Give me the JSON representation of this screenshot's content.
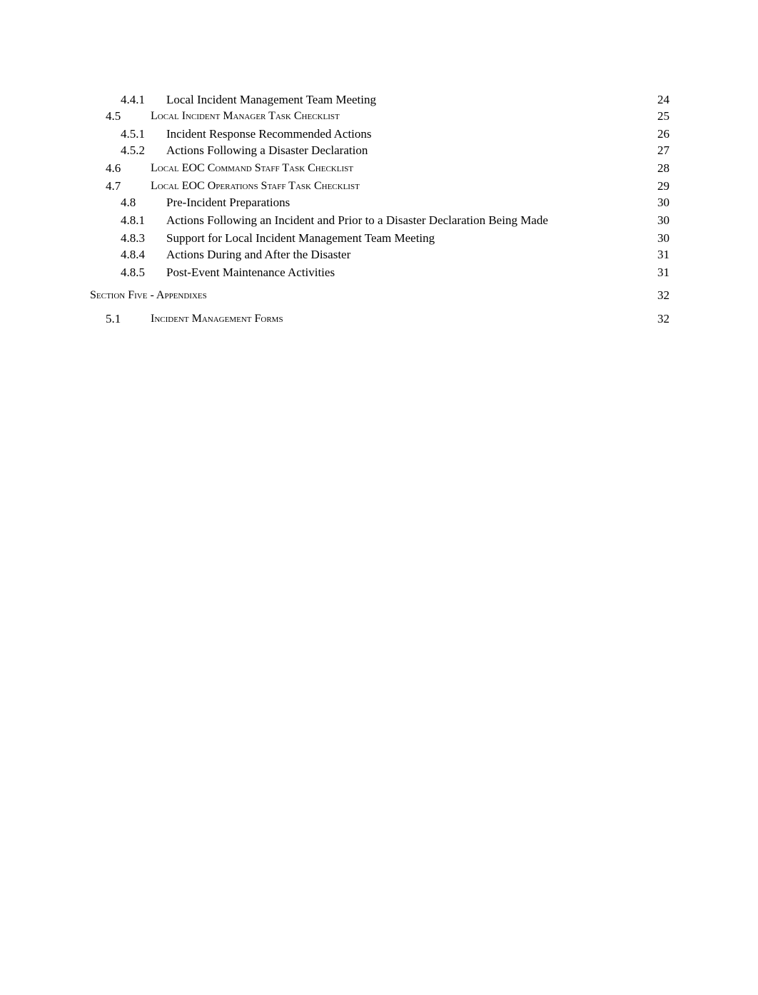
{
  "toc": {
    "entries": [
      {
        "number": "4.4.1",
        "title": "Local Incident Management Team Meeting",
        "page": "24",
        "level": 3
      },
      {
        "number": "4.5",
        "title": "Local Incident Manager Task Checklist",
        "page": "25",
        "level": 2
      },
      {
        "number": "4.5.1",
        "title": "Incident Response Recommended Actions",
        "page": "26",
        "level": 3
      },
      {
        "number": "4.5.2",
        "title": "Actions Following a Disaster Declaration",
        "page": "27",
        "level": 3
      },
      {
        "number": "4.6",
        "title": "Local EOC Command Staff  Task Checklist",
        "page": "28",
        "level": 2
      },
      {
        "number": "4.7",
        "title": "Local EOC Operations  Staff  Task Checklist",
        "page": "29",
        "level": 2
      },
      {
        "number": "4.8",
        "title": "Pre-Incident Preparations",
        "page": "30",
        "level": 3
      },
      {
        "number": "4.8.1",
        "title": "Actions Following an Incident and Prior to a Disaster Declaration Being Made",
        "page": "30",
        "level": 3
      },
      {
        "number": "4.8.3",
        "title": "Support for Local Incident Management Team Meeting",
        "page": "30",
        "level": 3
      },
      {
        "number": "4.8.4",
        "title": "Actions During and After the Disaster",
        "page": "31",
        "level": 3
      },
      {
        "number": "4.8.5",
        "title": "Post-Event Maintenance Activities",
        "page": "31",
        "level": 3
      },
      {
        "number": "",
        "title": "Section  Five - Appendixes",
        "page": "32",
        "level": 1
      },
      {
        "number": "5.1",
        "title": "Incident Management Forms",
        "page": "32",
        "level": 2
      }
    ]
  }
}
